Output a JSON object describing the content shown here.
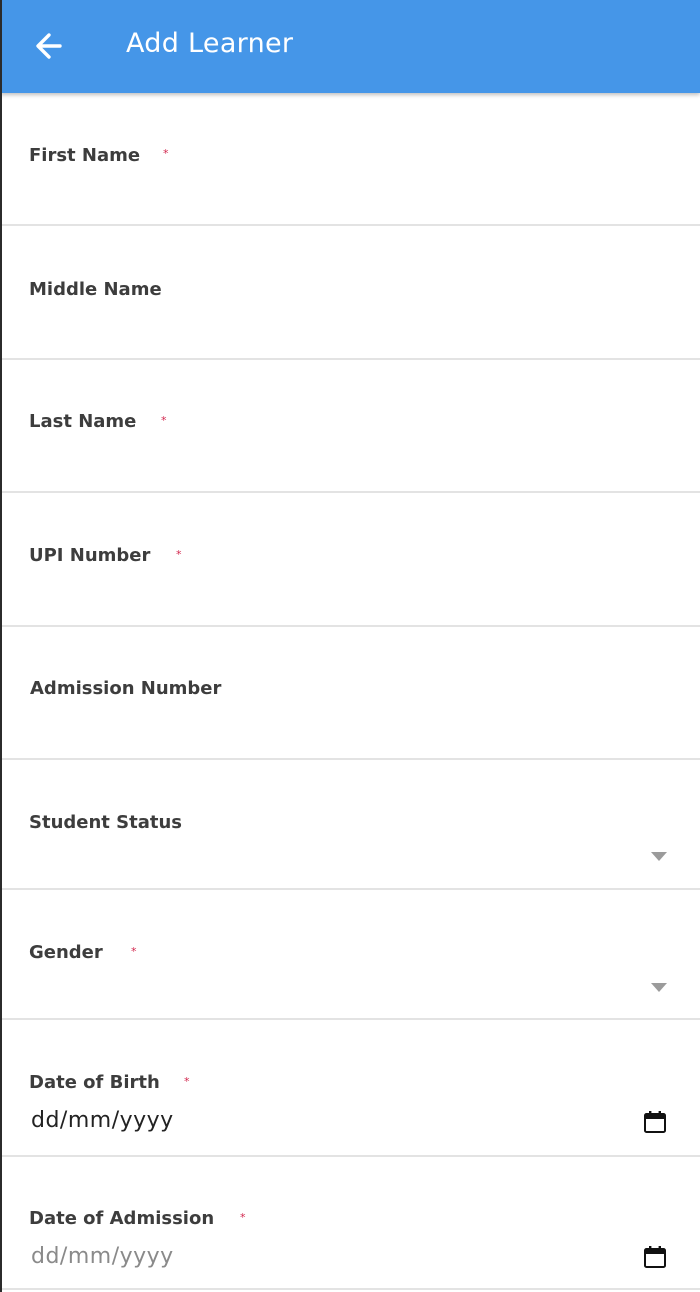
{
  "header": {
    "title": "Add Learner",
    "back_icon": "arrow-left-icon",
    "background": "#4596e8"
  },
  "required_marker": "*",
  "required_color": "#d2264d",
  "form": {
    "first_name": {
      "label": "First Name",
      "required": true,
      "value": ""
    },
    "middle_name": {
      "label": "Middle Name",
      "required": false,
      "value": ""
    },
    "last_name": {
      "label": "Last Name",
      "required": true,
      "value": ""
    },
    "upi_number": {
      "label": "UPI Number",
      "required": true,
      "value": ""
    },
    "admission_number": {
      "label": "Admission Number",
      "required": false,
      "value": ""
    },
    "student_status": {
      "label": "Student Status",
      "required": false,
      "selected": ""
    },
    "gender": {
      "label": "Gender",
      "required": true,
      "selected": ""
    },
    "date_of_birth": {
      "label": "Date of Birth",
      "required": true,
      "placeholder": "dd/mm/yyyy"
    },
    "date_of_admission": {
      "label": "Date of Admission",
      "required": true,
      "placeholder": "dd/mm/yyyy"
    }
  }
}
